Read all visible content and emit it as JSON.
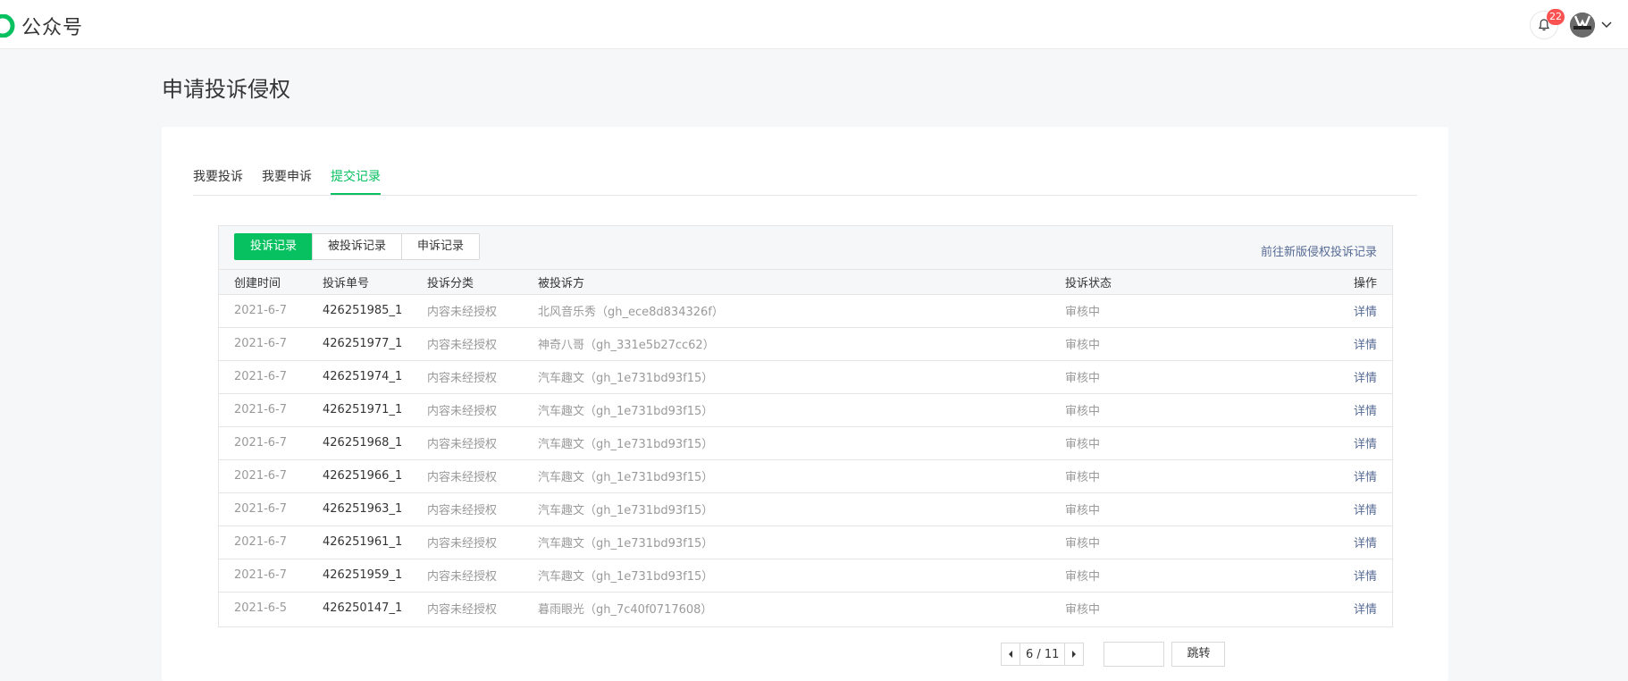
{
  "app": {
    "name": "公众号",
    "notification_count": "22"
  },
  "page": {
    "title": "申请投诉侵权"
  },
  "main_tabs": [
    {
      "label": "我要投诉",
      "active": false
    },
    {
      "label": "我要申诉",
      "active": false
    },
    {
      "label": "提交记录",
      "active": true
    }
  ],
  "record_tabs": [
    {
      "label": "投诉记录",
      "active": true
    },
    {
      "label": "被投诉记录",
      "active": false
    },
    {
      "label": "申诉记录",
      "active": false
    }
  ],
  "new_version_link": "前往新版侵权投诉记录",
  "table": {
    "columns": [
      "创建时间",
      "投诉单号",
      "投诉分类",
      "被投诉方",
      "投诉状态",
      "操作"
    ],
    "rows": [
      [
        "2021-6-7",
        "426251985_1",
        "内容未经授权",
        "北风音乐秀（gh_ece8d834326f）",
        "审核中",
        "详情"
      ],
      [
        "2021-6-7",
        "426251977_1",
        "内容未经授权",
        "神奇八哥（gh_331e5b27cc62）",
        "审核中",
        "详情"
      ],
      [
        "2021-6-7",
        "426251974_1",
        "内容未经授权",
        "汽车趣文（gh_1e731bd93f15）",
        "审核中",
        "详情"
      ],
      [
        "2021-6-7",
        "426251971_1",
        "内容未经授权",
        "汽车趣文（gh_1e731bd93f15）",
        "审核中",
        "详情"
      ],
      [
        "2021-6-7",
        "426251968_1",
        "内容未经授权",
        "汽车趣文（gh_1e731bd93f15）",
        "审核中",
        "详情"
      ],
      [
        "2021-6-7",
        "426251966_1",
        "内容未经授权",
        "汽车趣文（gh_1e731bd93f15）",
        "审核中",
        "详情"
      ],
      [
        "2021-6-7",
        "426251963_1",
        "内容未经授权",
        "汽车趣文（gh_1e731bd93f15）",
        "审核中",
        "详情"
      ],
      [
        "2021-6-7",
        "426251961_1",
        "内容未经授权",
        "汽车趣文（gh_1e731bd93f15）",
        "审核中",
        "详情"
      ],
      [
        "2021-6-7",
        "426251959_1",
        "内容未经授权",
        "汽车趣文（gh_1e731bd93f15）",
        "审核中",
        "详情"
      ],
      [
        "2021-6-5",
        "426250147_1",
        "内容未经授权",
        "暮雨眼光（gh_7c40f0717608）",
        "审核中",
        "详情"
      ]
    ]
  },
  "pagination": {
    "display": "6 / 11",
    "jump_input_value": "",
    "jump_label": "跳转"
  },
  "colors": {
    "accent": "#07c160",
    "link": "#576b95",
    "badge": "#fa5151"
  }
}
